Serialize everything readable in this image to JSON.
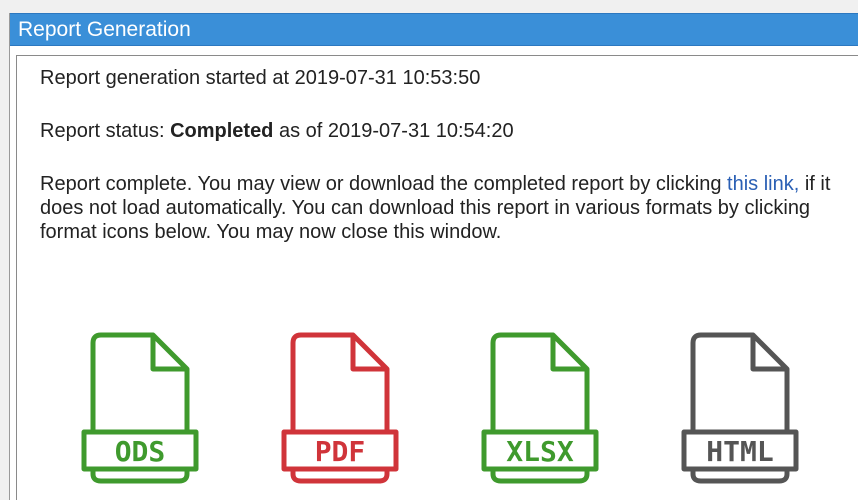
{
  "window": {
    "title": "Report Generation"
  },
  "report": {
    "started_prefix": "Report generation started at ",
    "started_time": "2019-07-31 10:53:50",
    "status_prefix": "Report status: ",
    "status_value": "Completed",
    "status_mid": " as of ",
    "status_time": "2019-07-31 10:54:20",
    "message_before_link": "Report complete. You may view or download the completed report by clicking ",
    "link_text": "this link,",
    "message_after_link": " if it does not load automatically. You can download this report in various formats by clicking format icons below. You may now close this window."
  },
  "formats": [
    {
      "label": "ODS",
      "color": "#3f9a2d",
      "icon": "ods-file-icon"
    },
    {
      "label": "PDF",
      "color": "#d0343a",
      "icon": "pdf-file-icon"
    },
    {
      "label": "XLSX",
      "color": "#3f9a2d",
      "icon": "xlsx-file-icon"
    },
    {
      "label": "HTML",
      "color": "#555555",
      "icon": "html-file-icon"
    }
  ]
}
